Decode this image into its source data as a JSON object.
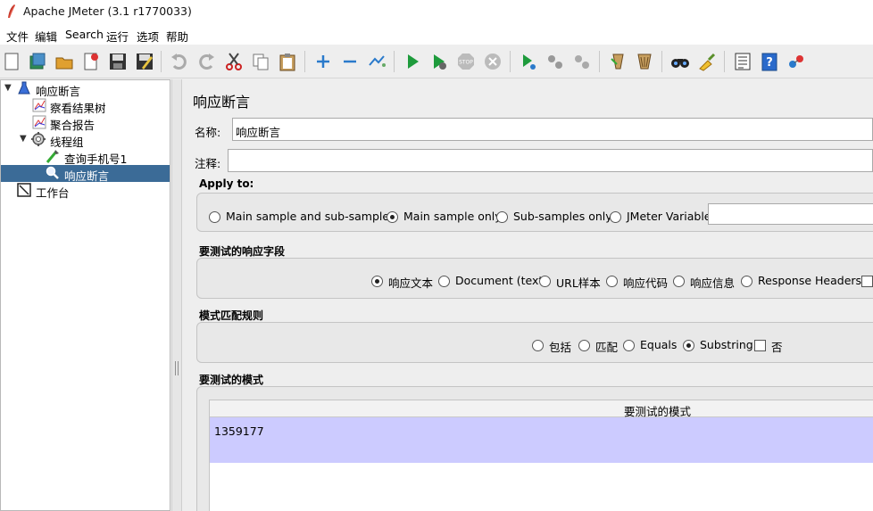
{
  "window": {
    "title": "Apache JMeter (3.1 r1770033)"
  },
  "menu": [
    "文件",
    "编辑",
    "Search",
    "运行",
    "选项",
    "帮助"
  ],
  "toolbar": {
    "icons": [
      "new-icon",
      "templates-icon",
      "open-icon",
      "close-icon",
      "save-icon",
      "save-as-icon",
      "undo-icon",
      "redo-icon",
      "cut-icon",
      "copy-icon",
      "paste-icon",
      "expand-icon",
      "collapse-icon",
      "toggle-icon",
      "start-icon",
      "start-no-pause-icon",
      "stop-icon",
      "shutdown-icon",
      "remote-start-icon",
      "remote-stop-icon",
      "remote-shutdown-icon",
      "clear-icon",
      "clear-all-icon",
      "search-icon",
      "reset-search-icon",
      "function-helper-icon",
      "help-icon",
      "remote-icon"
    ]
  },
  "tree": {
    "items": [
      {
        "label": "测试计划",
        "icon": "test-plan-icon",
        "expanded": true
      },
      {
        "label": "察看结果树",
        "icon": "listener-icon"
      },
      {
        "label": "聚合报告",
        "icon": "listener-icon"
      },
      {
        "label": "线程组",
        "icon": "thread-group-icon",
        "expanded": true
      },
      {
        "label": "查询手机号1",
        "icon": "sampler-icon"
      },
      {
        "label": "响应断言",
        "icon": "assertion-icon",
        "selected": true
      },
      {
        "label": "工作台",
        "icon": "workbench-icon"
      }
    ]
  },
  "panel": {
    "title": "响应断言",
    "name_label": "名称:",
    "name_value": "响应断言",
    "comment_label": "注释:",
    "comment_value": "",
    "apply_to": {
      "title": "Apply to:",
      "options": [
        "Main sample and sub-samples",
        "Main sample only",
        "Sub-samples only",
        "JMeter Variable"
      ],
      "selected": "Main sample only",
      "variable_value": ""
    },
    "field_to_test": {
      "title": "要测试的响应字段",
      "options": [
        "响应文本",
        "Document (text)",
        "URL样本",
        "响应代码",
        "响应信息",
        "Response Headers"
      ],
      "selected": "响应文本"
    },
    "pattern_rules": {
      "title": "模式匹配规则",
      "options": [
        "包括",
        "匹配",
        "Equals",
        "Substring"
      ],
      "selected": "Substring",
      "not_label": "否",
      "not_checked": false
    },
    "patterns": {
      "title": "要测试的模式",
      "column_header": "要测试的模式",
      "rows": [
        "1359177"
      ]
    }
  },
  "colors": {
    "selection": "#3b6b97",
    "table_row": "#cccbff"
  }
}
